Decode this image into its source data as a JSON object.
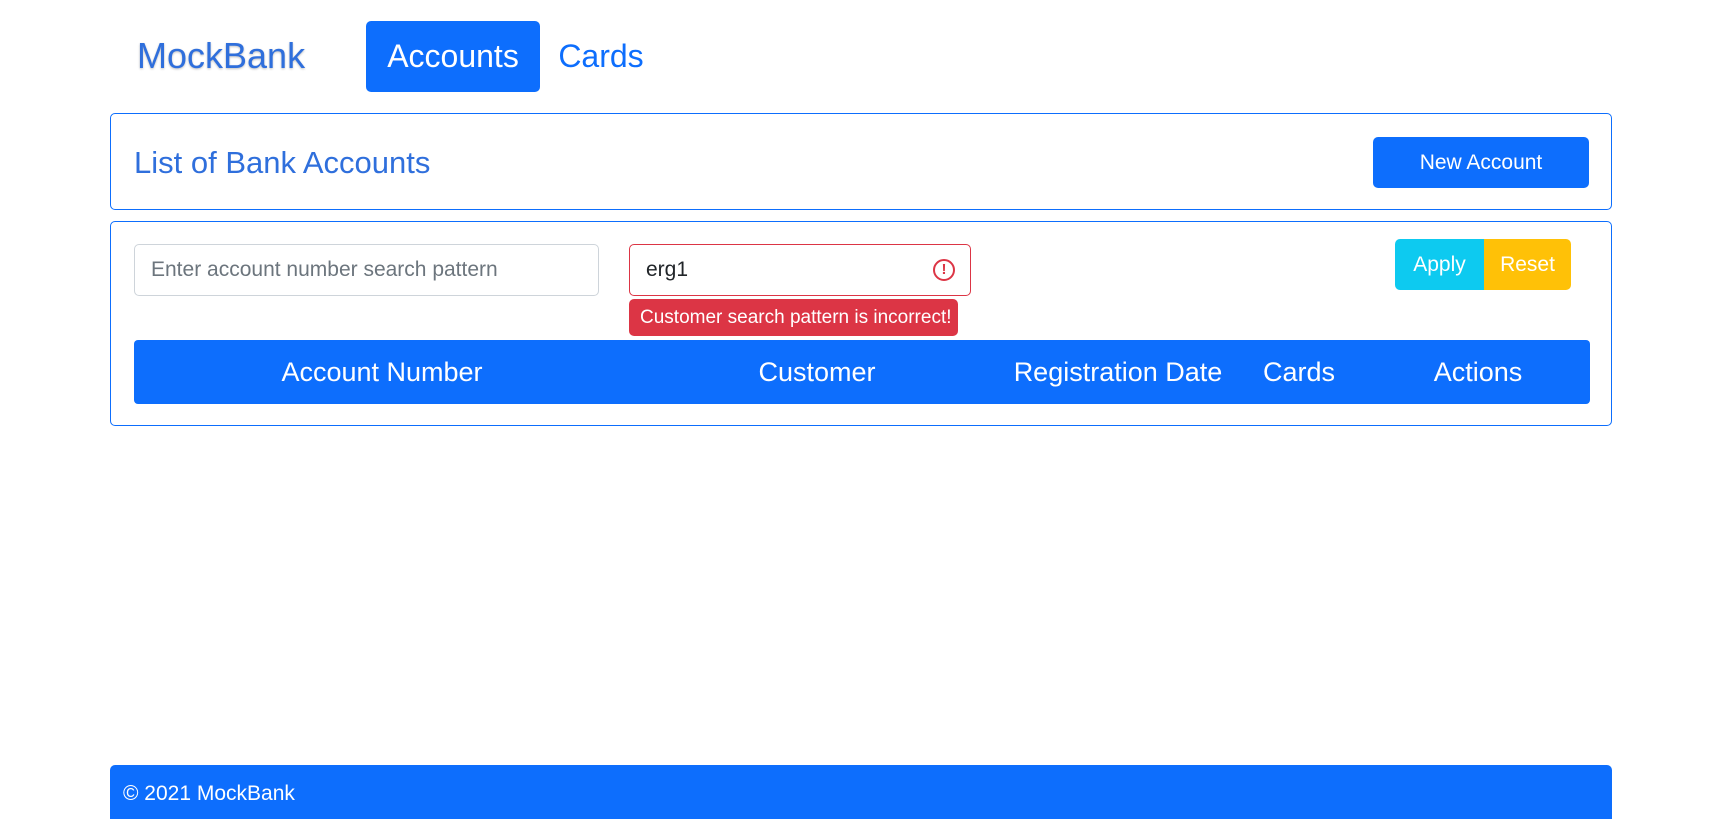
{
  "navbar": {
    "brand": "MockBank",
    "links": [
      {
        "label": "Accounts",
        "active": true
      },
      {
        "label": "Cards",
        "active": false
      }
    ]
  },
  "header": {
    "title": "List of Bank Accounts",
    "new_account_label": "New Account"
  },
  "filters": {
    "account_placeholder": "Enter account number search pattern",
    "account_value": "",
    "customer_value": "erg1",
    "customer_error": "Customer search pattern is incorrect!",
    "error_icon": "!",
    "apply_label": "Apply",
    "reset_label": "Reset"
  },
  "table": {
    "columns": [
      "Account Number",
      "Customer",
      "Registration Date",
      "Cards",
      "Actions"
    ],
    "rows": []
  },
  "footer": {
    "text": "© 2021 MockBank"
  },
  "colors": {
    "primary": "#0d6efd",
    "info": "#0dcaf0",
    "warning": "#ffc107",
    "danger": "#dc3545"
  }
}
